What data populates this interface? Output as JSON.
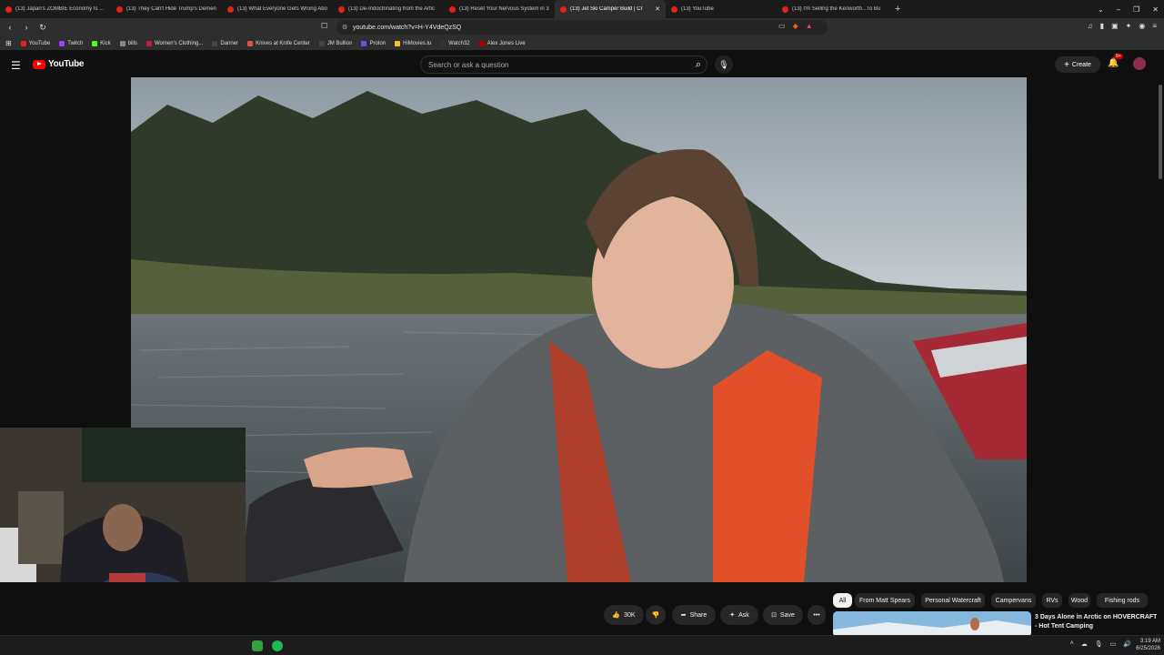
{
  "browser": {
    "tabs": [
      {
        "title": "(13) Japan's ZOMBIE Economy Is Abo",
        "active": false
      },
      {
        "title": "(13) They Can't Hide Trump's Demen",
        "active": false
      },
      {
        "title": "(13) What Everyone Gets Wrong Abo",
        "active": false
      },
      {
        "title": "(13) De-Indoctrinating from the Artic",
        "active": false
      },
      {
        "title": "(13) Reset Your Nervous System in 3",
        "active": false
      },
      {
        "title": "(13) Jet Ski Camper Build | Cr",
        "active": true
      },
      {
        "title": "(13) YouTube",
        "active": false
      },
      {
        "title": "(13) I'm Selling the Kenworth...To Bu",
        "active": false
      }
    ],
    "url": "youtube.com/watch?v=H-Y4VdeQzSQ",
    "bookmarks": [
      {
        "label": "YouTube",
        "color": "#e62117"
      },
      {
        "label": "Twitch",
        "color": "#9146ff"
      },
      {
        "label": "Kick",
        "color": "#53fc18"
      },
      {
        "label": "bills",
        "color": "#888888"
      },
      {
        "label": "Women's Clothing...",
        "color": "#c41e3a"
      },
      {
        "label": "Danner",
        "color": "#444444"
      },
      {
        "label": "Knives at Knife Center",
        "color": "#d9534f"
      },
      {
        "label": "JM Bullion",
        "color": "#444444"
      },
      {
        "label": "Proton",
        "color": "#6d4aff"
      },
      {
        "label": "HiMovies.lu",
        "color": "#f5c518"
      },
      {
        "label": "Watch32",
        "color": "#333333"
      },
      {
        "label": "Alex Jones Live",
        "color": "#b00000"
      }
    ]
  },
  "youtube": {
    "logo_text": "YouTube",
    "search_placeholder": "Search or ask a question",
    "create_label": "Create",
    "notification_count": "9+",
    "actions": {
      "like_count": "30K",
      "share_label": "Share",
      "ask_label": "Ask",
      "save_label": "Save"
    },
    "chips": [
      "All",
      "From Matt Spears",
      "Personal Watercraft",
      "Campervans",
      "RVs",
      "Wood",
      "Fishing rods"
    ],
    "recommendation": {
      "title": "3 Days Alone in Arctic on HOVERCRAFT - Hot Tent Camping"
    }
  },
  "taskbar": {
    "time": "3:19 AM",
    "date": "6/25/2026"
  }
}
